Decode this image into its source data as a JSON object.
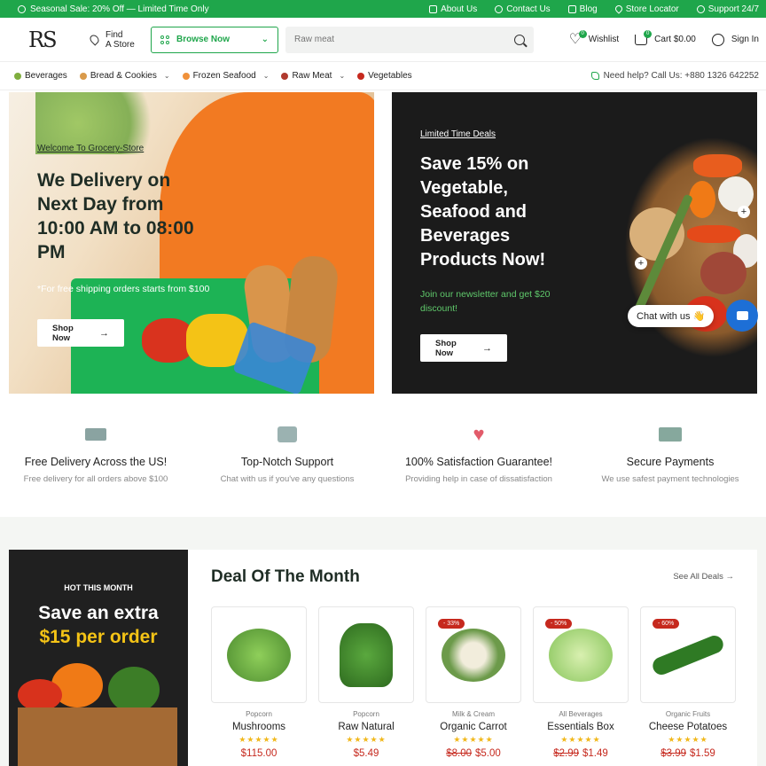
{
  "topbar": {
    "promo": "Seasonal Sale: 20% Off — Limited Time Only",
    "links": [
      "About Us",
      "Contact Us",
      "Blog",
      "Store Locator",
      "Support 24/7"
    ]
  },
  "header": {
    "logo": "RS",
    "find_line1": "Find",
    "find_line2": "A Store",
    "browse_label": "Browse Now",
    "search_placeholder": "Raw meat",
    "wishlist_label": "Wishlist",
    "wishlist_count": "0",
    "cart_label": "Cart $0.00",
    "cart_count": "0",
    "signin_label": "Sign In"
  },
  "categories": [
    {
      "label": "Beverages",
      "color": "#7fae3e"
    },
    {
      "label": "Bread & Cookies",
      "color": "#d99a4b"
    },
    {
      "label": "Frozen Seafood",
      "color": "#f0913a"
    },
    {
      "label": "Raw Meat",
      "color": "#b03a2e"
    },
    {
      "label": "Vegetables",
      "color": "#c6291e"
    }
  ],
  "help_text": "Need help? Call Us: +880 1326 642252",
  "hero_left": {
    "welcome": "Welcome To Grocery-Store",
    "title": "We Delivery on Next Day from 10:00 AM to 08:00 PM",
    "note": "*For free shipping orders starts from $100",
    "button": "Shop Now"
  },
  "hero_right": {
    "tag": "Limited Time Deals",
    "title": "Save 15% on Vegetable, Seafood and Beverages Products Now!",
    "subtitle": "Join our newsletter and get $20 discount!",
    "button": "Shop Now"
  },
  "chat": {
    "label": "Chat with us 👋"
  },
  "features": [
    {
      "title": "Free Delivery Across the US!",
      "subtitle": "Free delivery for all orders above $100",
      "icon": "truck-icon"
    },
    {
      "title": "Top-Notch Support",
      "subtitle": "Chat with us if you've any questions",
      "icon": "chat-bubble-icon"
    },
    {
      "title": "100% Satisfaction Guarantee!",
      "subtitle": "Providing help in case of dissatisfaction",
      "icon": "heart-icon"
    },
    {
      "title": "Secure Payments",
      "subtitle": "We use safest payment technologies",
      "icon": "cash-icon"
    }
  ],
  "promo_card": {
    "kicker": "HOT THIS MONTH",
    "line1": "Save an extra",
    "line2": "$15 per order"
  },
  "deals": {
    "title": "Deal Of The Month",
    "see_all": "See All Deals",
    "products": [
      {
        "category": "Popcorn",
        "name": "Mushrooms",
        "old_price": "",
        "price": "$115.00",
        "discount": "",
        "color": "#5f9c3a"
      },
      {
        "category": "Popcorn",
        "name": "Raw Natural",
        "old_price": "",
        "price": "$5.49",
        "discount": "",
        "color": "#3f8f2c"
      },
      {
        "category": "Milk & Cream",
        "name": "Organic Carrot",
        "old_price": "$8.00",
        "price": "$5.00",
        "discount": "- 33%",
        "color": "#7aa35a"
      },
      {
        "category": "All Beverages",
        "name": "Essentials Box",
        "old_price": "$2.99",
        "price": "$1.49",
        "discount": "- 50%",
        "color": "#86c45a"
      },
      {
        "category": "Organic Fruits",
        "name": "Cheese Potatoes",
        "old_price": "$3.99",
        "price": "$1.59",
        "discount": "- 60%",
        "color": "#2f7a24"
      }
    ]
  }
}
